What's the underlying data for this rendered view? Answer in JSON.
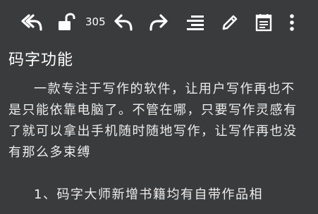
{
  "toolbar": {
    "items": [
      {
        "name": "undo-all-icon"
      },
      {
        "name": "unlock-icon"
      },
      {
        "name": "undo-icon"
      },
      {
        "name": "redo-icon"
      },
      {
        "name": "format-align-icon"
      },
      {
        "name": "edit-pencil-icon"
      },
      {
        "name": "calendar-notes-icon"
      },
      {
        "name": "more-vertical-icon"
      }
    ],
    "word_count": "305"
  },
  "document": {
    "title": "码字功能",
    "paragraphs": [
      "一款专注于写作的软件，让用户写作再也不是只能依靠电脑了。不管在哪，只要写作灵感有了就可以拿出手机随时随地写作，让写作再也没有那么多束缚",
      "1、码字大师新增书籍均有自带作品相"
    ]
  },
  "colors": {
    "background": "#3a3b3d",
    "text": "#ececec",
    "icon": "#ffffff"
  }
}
